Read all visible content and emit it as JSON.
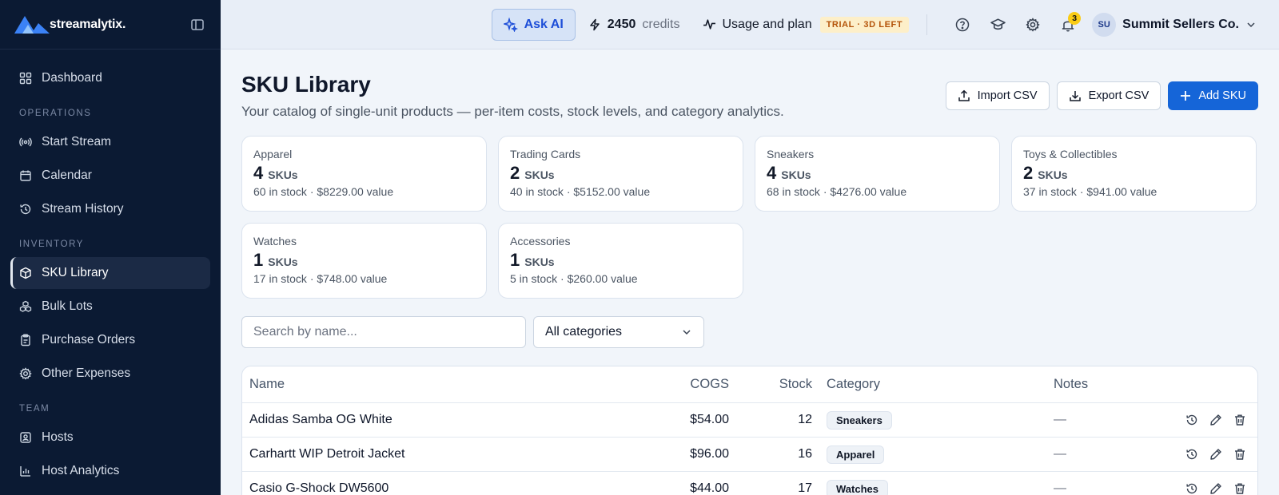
{
  "brand": {
    "name": "streamalytix."
  },
  "sidebar": {
    "top": [
      {
        "label": "Dashboard",
        "icon": "grid-icon"
      }
    ],
    "sections": [
      {
        "title": "OPERATIONS",
        "items": [
          {
            "label": "Start Stream",
            "icon": "broadcast-icon"
          },
          {
            "label": "Calendar",
            "icon": "calendar-icon"
          },
          {
            "label": "Stream History",
            "icon": "history-icon"
          }
        ]
      },
      {
        "title": "INVENTORY",
        "items": [
          {
            "label": "SKU Library",
            "icon": "box-icon",
            "active": true
          },
          {
            "label": "Bulk Lots",
            "icon": "boxes-icon"
          },
          {
            "label": "Purchase Orders",
            "icon": "clipboard-icon"
          },
          {
            "label": "Other Expenses",
            "icon": "gear-icon"
          }
        ]
      },
      {
        "title": "TEAM",
        "items": [
          {
            "label": "Hosts",
            "icon": "contact-icon"
          },
          {
            "label": "Host Analytics",
            "icon": "bar-chart-icon"
          }
        ]
      }
    ]
  },
  "topbar": {
    "ask_ai": "Ask AI",
    "credits_value": "2450",
    "credits_unit": "credits",
    "usage_label": "Usage and plan",
    "trial_badge": "TRIAL · 3D LEFT",
    "notification_count": "3",
    "avatar_initials": "SU",
    "account_name": "Summit Sellers Co."
  },
  "page": {
    "title": "SKU Library",
    "subtitle": "Your catalog of single-unit products — per-item costs, stock levels, and category analytics.",
    "import_label": "Import CSV",
    "export_label": "Export CSV",
    "add_label": "Add SKU"
  },
  "categories": [
    {
      "name": "Apparel",
      "count": "4",
      "unit": "SKUs",
      "meta": "60 in stock · $8229.00 value"
    },
    {
      "name": "Trading Cards",
      "count": "2",
      "unit": "SKUs",
      "meta": "40 in stock · $5152.00 value"
    },
    {
      "name": "Sneakers",
      "count": "4",
      "unit": "SKUs",
      "meta": "68 in stock · $4276.00 value"
    },
    {
      "name": "Toys & Collectibles",
      "count": "2",
      "unit": "SKUs",
      "meta": "37 in stock · $941.00 value"
    },
    {
      "name": "Watches",
      "count": "1",
      "unit": "SKUs",
      "meta": "17 in stock · $748.00 value"
    },
    {
      "name": "Accessories",
      "count": "1",
      "unit": "SKUs",
      "meta": "5 in stock · $260.00 value"
    }
  ],
  "filters": {
    "search_placeholder": "Search by name...",
    "category_selected": "All categories"
  },
  "table": {
    "headers": {
      "name": "Name",
      "cogs": "COGS",
      "stock": "Stock",
      "category": "Category",
      "notes": "Notes"
    },
    "rows": [
      {
        "name": "Adidas Samba OG White",
        "cogs": "$54.00",
        "stock": "12",
        "category": "Sneakers",
        "notes": "—"
      },
      {
        "name": "Carhartt WIP Detroit Jacket",
        "cogs": "$96.00",
        "stock": "16",
        "category": "Apparel",
        "notes": "—"
      },
      {
        "name": "Casio G-Shock DW5600",
        "cogs": "$44.00",
        "stock": "17",
        "category": "Watches",
        "notes": "—"
      }
    ]
  }
}
